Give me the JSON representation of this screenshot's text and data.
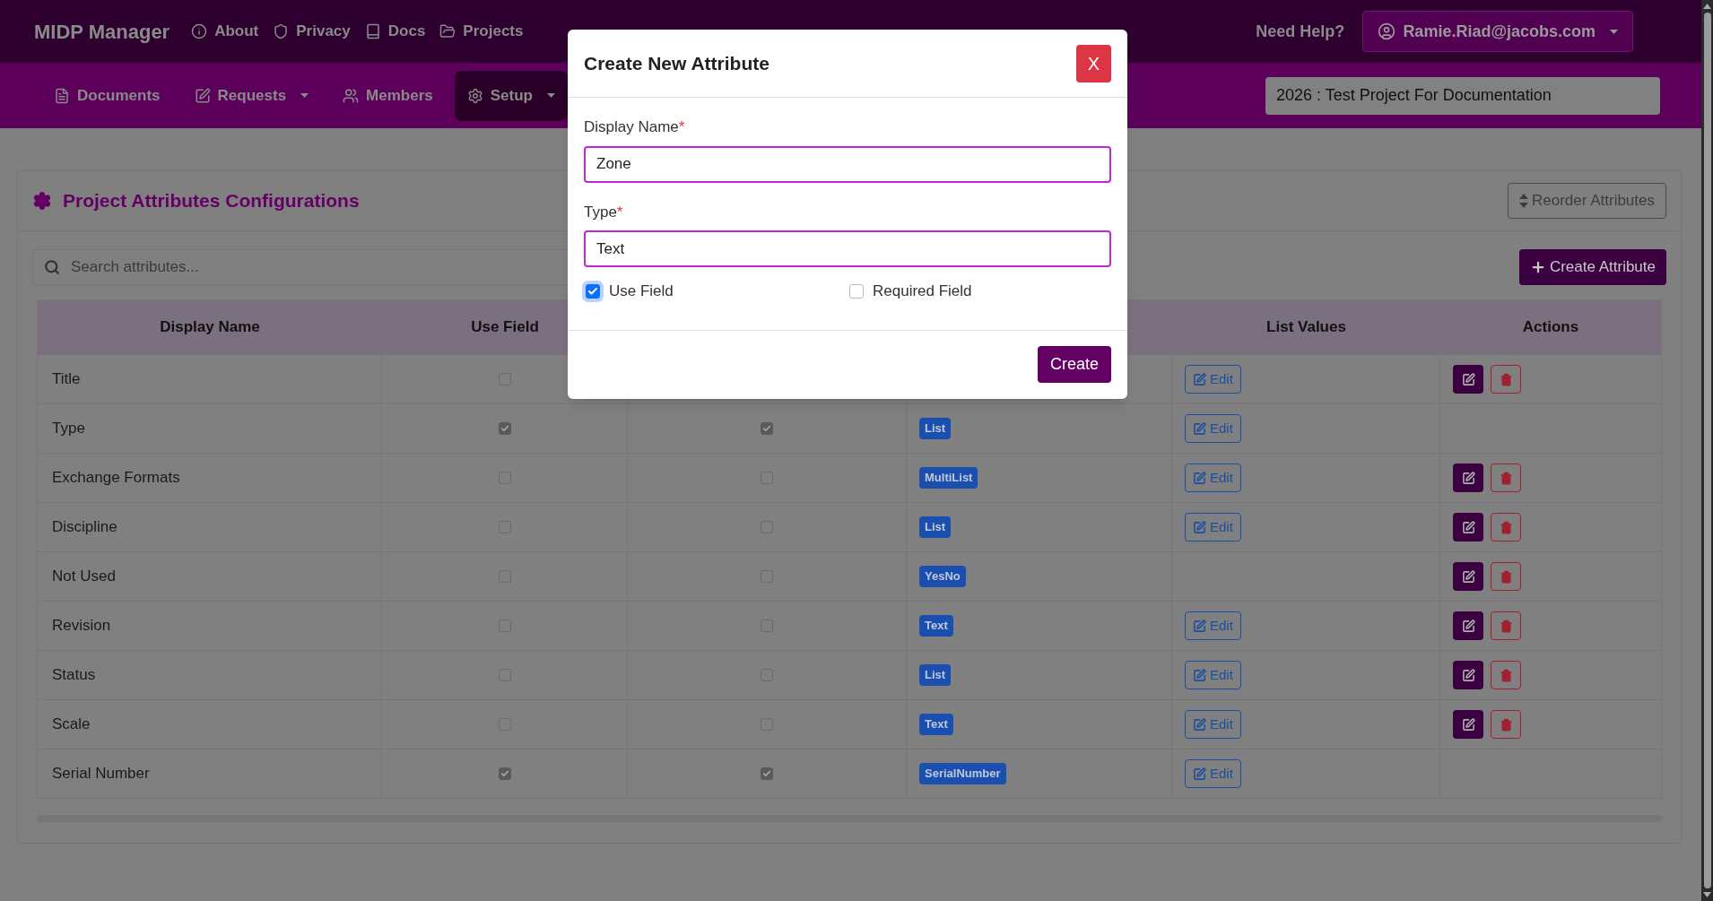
{
  "top_nav": {
    "brand": "MIDP Manager",
    "links": [
      {
        "label": "About"
      },
      {
        "label": "Privacy"
      },
      {
        "label": "Docs"
      },
      {
        "label": "Projects"
      }
    ],
    "help": "Need Help?",
    "user": "Ramie.Riad@jacobs.com"
  },
  "sub_nav": {
    "tabs": [
      {
        "label": "Documents",
        "selected": false,
        "dropdown": false
      },
      {
        "label": "Requests",
        "selected": false,
        "dropdown": true
      },
      {
        "label": "Members",
        "selected": false,
        "dropdown": false
      },
      {
        "label": "Setup",
        "selected": true,
        "dropdown": true
      }
    ],
    "project": "2026 : Test Project For Documentation"
  },
  "page": {
    "title": "Project Attributes Configurations",
    "reorder_button": "Reorder Attributes",
    "search_placeholder": "Search attributes...",
    "create_button": "Create Attribute"
  },
  "table": {
    "columns": {
      "display_name": "Display Name",
      "use_field": "Use Field",
      "list_values": "List Values",
      "actions": "Actions"
    },
    "rows": [
      {
        "name": "Title",
        "use_field": false,
        "list_values": "Edit",
        "actions": true
      },
      {
        "name": "Type",
        "use_field": true,
        "required": true,
        "type": "List",
        "list_values": "Edit",
        "actions": false
      },
      {
        "name": "Exchange Formats",
        "use_field": false,
        "required": false,
        "type": "MultiList",
        "list_values": "Edit",
        "actions": true
      },
      {
        "name": "Discipline",
        "use_field": false,
        "required": false,
        "type": "List",
        "list_values": "Edit",
        "actions": true
      },
      {
        "name": "Not Used",
        "use_field": false,
        "required": false,
        "type": "YesNo",
        "actions": true
      },
      {
        "name": "Revision",
        "use_field": false,
        "required": false,
        "type": "Text",
        "list_values": "Edit",
        "actions": true
      },
      {
        "name": "Status",
        "use_field": false,
        "required": false,
        "type": "List",
        "list_values": "Edit",
        "actions": true
      },
      {
        "name": "Scale",
        "use_field": false,
        "required": false,
        "type": "Text",
        "list_values": "Edit",
        "actions": true
      },
      {
        "name": "Serial Number",
        "use_field": true,
        "required": true,
        "type": "SerialNumber",
        "list_values": "Edit",
        "actions": false
      }
    ]
  },
  "modal": {
    "title": "Create New Attribute",
    "close": "X",
    "fields": [
      {
        "label": "Display Name",
        "mark": "*",
        "value": "Zone"
      },
      {
        "label": "Type",
        "mark": "*",
        "value": "Text"
      }
    ],
    "checkboxes": [
      {
        "label": "Use Field",
        "checked": true
      },
      {
        "label": "Required Field",
        "checked": false
      }
    ],
    "submit": "Create"
  }
}
